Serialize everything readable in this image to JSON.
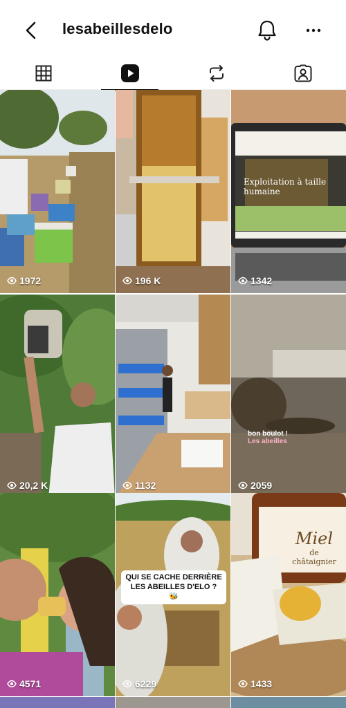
{
  "header": {
    "title": "lesabeillesdelo"
  },
  "tabs": [
    {
      "name": "grid",
      "icon": "grid-icon",
      "active": false
    },
    {
      "name": "reels",
      "icon": "reels-icon",
      "active": true
    },
    {
      "name": "reposts",
      "icon": "repost-icon",
      "active": false
    },
    {
      "name": "tagged",
      "icon": "tagged-person-icon",
      "active": false
    }
  ],
  "reels": [
    {
      "views": "1972"
    },
    {
      "views": "196 K"
    },
    {
      "views": "1342",
      "overlay": "Exploitation à taille humaine"
    },
    {
      "views": "20,2 K"
    },
    {
      "views": "1132"
    },
    {
      "views": "2059",
      "overlay_line1": "bon boulot !",
      "overlay_line2": "Les abeilles"
    },
    {
      "views": "4571"
    },
    {
      "views": "6229",
      "overlay": "QUI SE CACHE DERRIÈRE LES ABEILLES D'ELO ? 🐝"
    },
    {
      "views": "1433",
      "label_line1": "Miel",
      "label_line2": "de châtaignier"
    }
  ],
  "colors": {
    "text": "#111111",
    "background": "#ffffff"
  }
}
